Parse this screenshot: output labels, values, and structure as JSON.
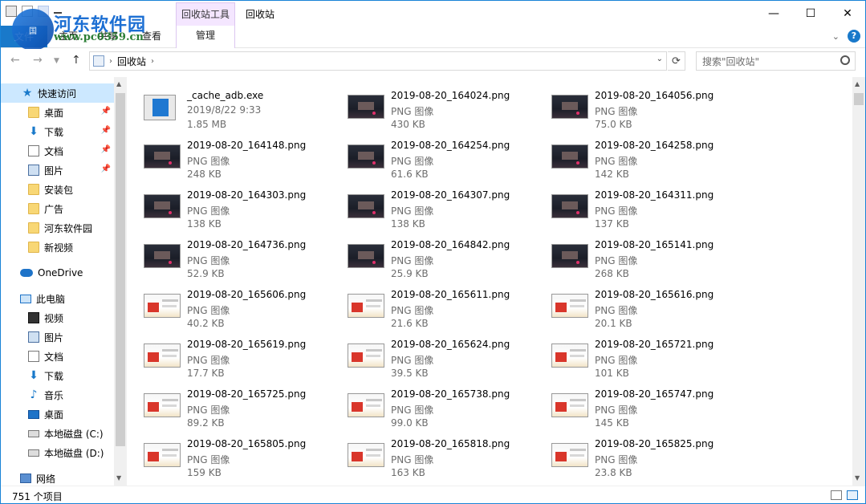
{
  "window": {
    "title": "回收站",
    "context_tab": "回收站工具",
    "minimize": "—",
    "maximize": "☐",
    "close": "✕"
  },
  "watermark": {
    "site": "河东软件园",
    "url": "www.pc0359.cn",
    "badge": "国"
  },
  "ribbon": {
    "file": "文件",
    "tabs": [
      "主页",
      "共享",
      "查看"
    ],
    "manage": "管理",
    "help": "?"
  },
  "address": {
    "path": "回收站",
    "search_placeholder": "搜索\"回收站\""
  },
  "sidebar": {
    "items": [
      {
        "label": "快速访问",
        "icon": "star-icon"
      },
      {
        "label": "桌面",
        "icon": "folder-icon",
        "pinned": true
      },
      {
        "label": "下载",
        "icon": "download-icon",
        "pinned": true
      },
      {
        "label": "文档",
        "icon": "document-icon",
        "pinned": true
      },
      {
        "label": "图片",
        "icon": "picture-icon",
        "pinned": true
      },
      {
        "label": "安装包",
        "icon": "folder-icon"
      },
      {
        "label": "广告",
        "icon": "folder-icon"
      },
      {
        "label": "河东软件园",
        "icon": "folder-icon"
      },
      {
        "label": "新视频",
        "icon": "folder-icon"
      },
      {
        "label": "OneDrive",
        "icon": "cloud-icon"
      },
      {
        "label": "此电脑",
        "icon": "computer-icon"
      },
      {
        "label": "视频",
        "icon": "video-icon"
      },
      {
        "label": "图片",
        "icon": "picture-icon"
      },
      {
        "label": "文档",
        "icon": "document-icon"
      },
      {
        "label": "下载",
        "icon": "download-icon"
      },
      {
        "label": "音乐",
        "icon": "music-icon"
      },
      {
        "label": "桌面",
        "icon": "desktop-icon"
      },
      {
        "label": "本地磁盘 (C:)",
        "icon": "drive-icon"
      },
      {
        "label": "本地磁盘 (D:)",
        "icon": "drive-icon"
      },
      {
        "label": "网络",
        "icon": "network-icon"
      }
    ]
  },
  "files": [
    {
      "name": "_cache_adb.exe",
      "type": "2019/8/22 9:33",
      "size": "1.85 MB",
      "thumb": "exe"
    },
    {
      "name": "2019-08-20_164024.png",
      "type": "PNG 图像",
      "size": "430 KB",
      "thumb": "dark"
    },
    {
      "name": "2019-08-20_164056.png",
      "type": "PNG 图像",
      "size": "75.0 KB",
      "thumb": "dark"
    },
    {
      "name": "2019-08-20_164148.png",
      "type": "PNG 图像",
      "size": "248 KB",
      "thumb": "dark"
    },
    {
      "name": "2019-08-20_164254.png",
      "type": "PNG 图像",
      "size": "61.6 KB",
      "thumb": "dark"
    },
    {
      "name": "2019-08-20_164258.png",
      "type": "PNG 图像",
      "size": "142 KB",
      "thumb": "dark"
    },
    {
      "name": "2019-08-20_164303.png",
      "type": "PNG 图像",
      "size": "138 KB",
      "thumb": "dark"
    },
    {
      "name": "2019-08-20_164307.png",
      "type": "PNG 图像",
      "size": "138 KB",
      "thumb": "dark"
    },
    {
      "name": "2019-08-20_164311.png",
      "type": "PNG 图像",
      "size": "137 KB",
      "thumb": "dark"
    },
    {
      "name": "2019-08-20_164736.png",
      "type": "PNG 图像",
      "size": "52.9 KB",
      "thumb": "dark"
    },
    {
      "name": "2019-08-20_164842.png",
      "type": "PNG 图像",
      "size": "25.9 KB",
      "thumb": "dark"
    },
    {
      "name": "2019-08-20_165141.png",
      "type": "PNG 图像",
      "size": "268 KB",
      "thumb": "dark"
    },
    {
      "name": "2019-08-20_165606.png",
      "type": "PNG 图像",
      "size": "40.2 KB",
      "thumb": "light"
    },
    {
      "name": "2019-08-20_165611.png",
      "type": "PNG 图像",
      "size": "21.6 KB",
      "thumb": "light"
    },
    {
      "name": "2019-08-20_165616.png",
      "type": "PNG 图像",
      "size": "20.1 KB",
      "thumb": "light"
    },
    {
      "name": "2019-08-20_165619.png",
      "type": "PNG 图像",
      "size": "17.7 KB",
      "thumb": "light"
    },
    {
      "name": "2019-08-20_165624.png",
      "type": "PNG 图像",
      "size": "39.5 KB",
      "thumb": "light"
    },
    {
      "name": "2019-08-20_165721.png",
      "type": "PNG 图像",
      "size": "101 KB",
      "thumb": "light"
    },
    {
      "name": "2019-08-20_165725.png",
      "type": "PNG 图像",
      "size": "89.2 KB",
      "thumb": "light"
    },
    {
      "name": "2019-08-20_165738.png",
      "type": "PNG 图像",
      "size": "99.0 KB",
      "thumb": "light"
    },
    {
      "name": "2019-08-20_165747.png",
      "type": "PNG 图像",
      "size": "145 KB",
      "thumb": "light"
    },
    {
      "name": "2019-08-20_165805.png",
      "type": "PNG 图像",
      "size": "159 KB",
      "thumb": "light"
    },
    {
      "name": "2019-08-20_165818.png",
      "type": "PNG 图像",
      "size": "163 KB",
      "thumb": "light"
    },
    {
      "name": "2019-08-20_165825.png",
      "type": "PNG 图像",
      "size": "23.8 KB",
      "thumb": "light"
    }
  ],
  "status": {
    "count": "751 个项目"
  },
  "colors": {
    "accent": "#1979ca",
    "selection": "#cce8ff",
    "context_tab": "#f4e6ff"
  }
}
